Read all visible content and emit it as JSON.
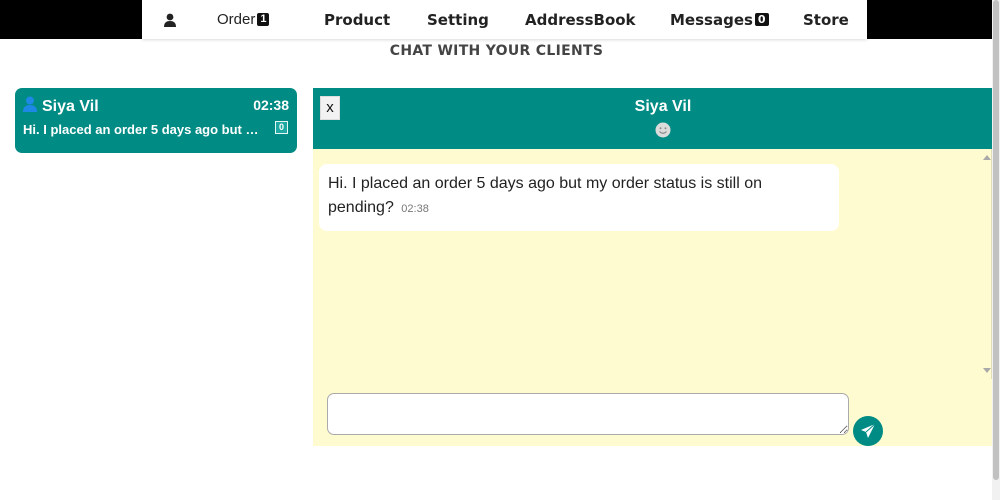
{
  "nav": {
    "user_icon": "user-icon",
    "order_label": "Order",
    "order_count": "1",
    "product_label": "Product",
    "setting_label": "Setting",
    "addressbook_label": "AddressBook",
    "messages_label": "Messages",
    "messages_count": "0",
    "store_label": "Store"
  },
  "page": {
    "title": "CHAT WITH YOUR CLIENTS"
  },
  "conversations": [
    {
      "name": "Siya Vil",
      "time": "02:38",
      "preview": "Hi. I placed an order 5 days ago but my order status is still on pending?",
      "unread": "0"
    }
  ],
  "chat": {
    "close_label": "x",
    "contact_name": "Siya Vil",
    "status_icon": "smiley-icon",
    "messages": [
      {
        "text": "Hi. I placed an order 5 days ago but my order status is still on pending?",
        "time": "02:38"
      }
    ],
    "compose_placeholder": "",
    "send_icon": "paper-plane-icon"
  },
  "colors": {
    "accent": "#008b84",
    "chat_background": "#fffbd0",
    "topbar": "#000000"
  }
}
